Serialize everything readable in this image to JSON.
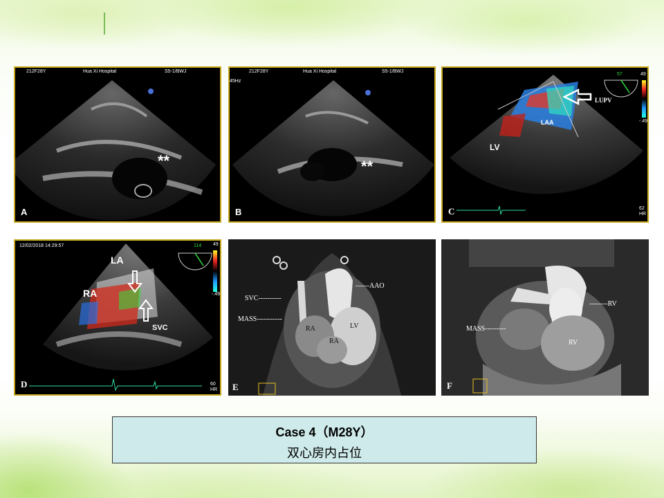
{
  "slide": {
    "caption_title": "Case 4（M28Y）",
    "caption_subtitle": "双心房内占位"
  },
  "panels": {
    "a": {
      "label": "A",
      "header": {
        "left": "212F28Y",
        "center": "Hua Xi Hospital",
        "right": "S5-1/BWJ"
      },
      "annotations": [
        "**"
      ]
    },
    "b": {
      "label": "B",
      "header": {
        "left": "212F28Y",
        "center": "Hua Xi Hospital",
        "right": "S5-1/BWJ"
      },
      "side_text": "45Hz",
      "annotations": [
        "**"
      ]
    },
    "c": {
      "label": "C",
      "annotations": [
        "LUPV",
        "LAA",
        "LV"
      ],
      "corner_text": "62\nHR",
      "scale_top": "49",
      "scale_bottom": "-.49",
      "scale_mid": "57"
    },
    "d": {
      "label": "D",
      "timestamp": "12/02/2018 14:29:57",
      "annotations": [
        "LA",
        "RA",
        "SVC"
      ],
      "corner_text": "60\nHR",
      "scale_top": "49",
      "scale_bottom": "-.49",
      "scale_mid": "114"
    },
    "e": {
      "label": "E",
      "annotations": [
        "SVC",
        "MASS",
        "AAO",
        "RA",
        "RA",
        "LV"
      ]
    },
    "f": {
      "label": "F",
      "annotations": [
        "MASS",
        "RV",
        "RV"
      ]
    }
  },
  "colors": {
    "panel_border": "#c8a81e",
    "caption_bg": "#cfeaea"
  }
}
